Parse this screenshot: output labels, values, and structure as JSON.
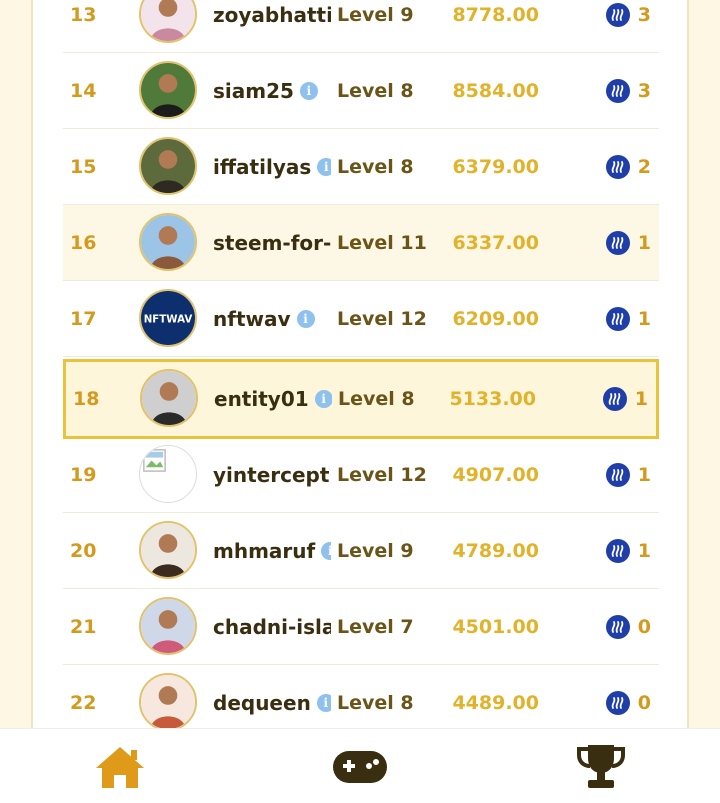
{
  "leaderboard": {
    "rows": [
      {
        "rank": "13",
        "username": "zoyabhatti",
        "has_info": false,
        "level": "Level 9",
        "points": "8778.00",
        "reward": "3",
        "avatar": "avatar-user-13"
      },
      {
        "rank": "14",
        "username": "siam25",
        "has_info": true,
        "level": "Level 8",
        "points": "8584.00",
        "reward": "3",
        "avatar": "avatar-user-14"
      },
      {
        "rank": "15",
        "username": "iffatilyas",
        "has_info": true,
        "level": "Level 8",
        "points": "6379.00",
        "reward": "2",
        "avatar": "avatar-user-15"
      },
      {
        "rank": "16",
        "username": "steem-for-",
        "has_info": false,
        "level": "Level 11",
        "points": "6337.00",
        "reward": "1",
        "avatar": "avatar-user-16"
      },
      {
        "rank": "17",
        "username": "nftwav",
        "has_info": true,
        "level": "Level 12",
        "points": "6209.00",
        "reward": "1",
        "avatar": "avatar-user-17"
      },
      {
        "rank": "18",
        "username": "entity01",
        "has_info": true,
        "level": "Level 8",
        "points": "5133.00",
        "reward": "1",
        "avatar": "avatar-user-18",
        "current_user": true
      },
      {
        "rank": "19",
        "username": "yintercept",
        "has_info": false,
        "level": "Level 12",
        "points": "4907.00",
        "reward": "1",
        "avatar": "broken-image"
      },
      {
        "rank": "20",
        "username": "mhmaruf",
        "has_info": true,
        "level": "Level 9",
        "points": "4789.00",
        "reward": "1",
        "avatar": "avatar-user-20"
      },
      {
        "rank": "21",
        "username": "chadni-isla",
        "has_info": false,
        "level": "Level 7",
        "points": "4501.00",
        "reward": "0",
        "avatar": "avatar-user-21"
      },
      {
        "rank": "22",
        "username": "dequeen",
        "has_info": true,
        "level": "Level 8",
        "points": "4489.00",
        "reward": "0",
        "avatar": "avatar-user-22"
      }
    ],
    "avatar_logo_text": "NFTWAV"
  },
  "icons": {
    "info": "info-icon",
    "reward": "steem-icon",
    "info_glyph": "i"
  },
  "nav": {
    "items": [
      {
        "name": "home",
        "icon": "home-icon"
      },
      {
        "name": "games",
        "icon": "gamepad-icon"
      },
      {
        "name": "leaderboard",
        "icon": "trophy-icon"
      }
    ]
  },
  "colors": {
    "accent": "#d49a1e",
    "points": "#e2b22a",
    "highlight_border": "#e7c43c",
    "steem_blue": "#1f3ea8",
    "nav_icon": "#e09a1a"
  }
}
